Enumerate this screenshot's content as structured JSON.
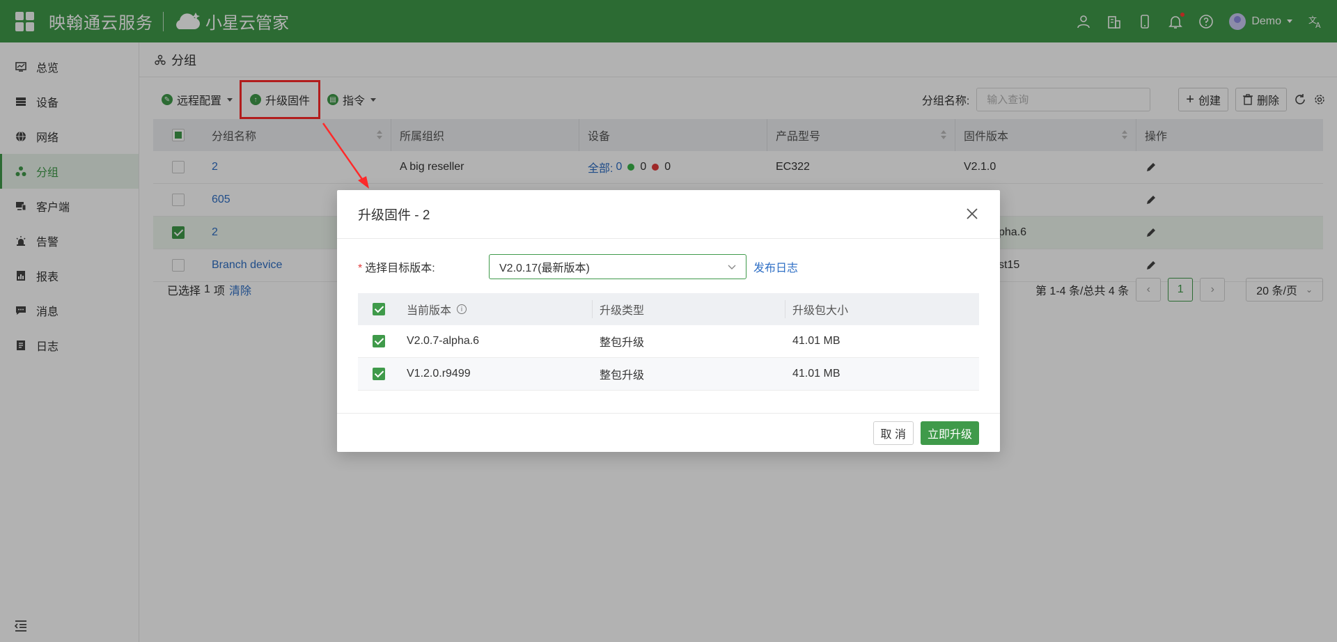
{
  "header": {
    "brand_primary": "映翰通云服务",
    "brand_secondary": "小星云管家",
    "user_name": "Demo",
    "accent_color": "#3f9a4a"
  },
  "sidebar": {
    "items": [
      {
        "label": "总览",
        "icon": "dashboard-icon"
      },
      {
        "label": "设备",
        "icon": "device-icon"
      },
      {
        "label": "网络",
        "icon": "globe-icon"
      },
      {
        "label": "分组",
        "icon": "group-icon",
        "active": true
      },
      {
        "label": "客户端",
        "icon": "client-icon"
      },
      {
        "label": "告警",
        "icon": "alarm-icon"
      },
      {
        "label": "报表",
        "icon": "report-icon"
      },
      {
        "label": "消息",
        "icon": "message-icon"
      },
      {
        "label": "日志",
        "icon": "log-icon"
      }
    ]
  },
  "page": {
    "title": "分组"
  },
  "toolbar": {
    "remote_config": "远程配置",
    "upgrade_firmware": "升级固件",
    "command": "指令",
    "search_label": "分组名称:",
    "search_placeholder": "输入查询",
    "create": "创建",
    "delete": "删除"
  },
  "table": {
    "columns": [
      "分组名称",
      "所属组织",
      "设备",
      "产品型号",
      "固件版本",
      "操作"
    ],
    "rows": [
      {
        "name": "2",
        "org": "A big reseller",
        "device_all_label": "全部:",
        "device_all": "0",
        "device_online": "0",
        "device_offline": "0",
        "model": "EC322",
        "firmware": "V2.1.0",
        "selected": false
      },
      {
        "name": "605",
        "org": "",
        "device_all_label": "",
        "device_all": "",
        "device_online": "",
        "device_offline": "",
        "model": "",
        "firmware": "",
        "selected": false
      },
      {
        "name": "2",
        "org": "",
        "device_all_label": "",
        "device_all": "",
        "device_online": "",
        "device_offline": "",
        "model": "",
        "firmware": "pha.6",
        "selected": true
      },
      {
        "name": "Branch device",
        "org": "",
        "device_all_label": "",
        "device_all": "",
        "device_online": "",
        "device_offline": "",
        "model": "",
        "firmware": "st15",
        "selected": false
      }
    ]
  },
  "footer": {
    "selected_prefix": "已选择",
    "selected_count": "1",
    "selected_suffix": "项",
    "clear": "清除",
    "page_summary": "第 1-4 条/总共 4 条",
    "current_page": "1",
    "page_size": "20 条/页"
  },
  "modal": {
    "title": "升级固件 - 2",
    "target_version_label": "选择目标版本:",
    "target_version_value": "V2.0.17(最新版本)",
    "release_log": "发布日志",
    "columns": [
      "当前版本",
      "升级类型",
      "升级包大小"
    ],
    "rows": [
      {
        "version": "V2.0.7-alpha.6",
        "type": "整包升级",
        "size": "41.01 MB"
      },
      {
        "version": "V1.2.0.r9499",
        "type": "整包升级",
        "size": "41.01 MB"
      }
    ],
    "cancel": "取 消",
    "confirm": "立即升级"
  }
}
